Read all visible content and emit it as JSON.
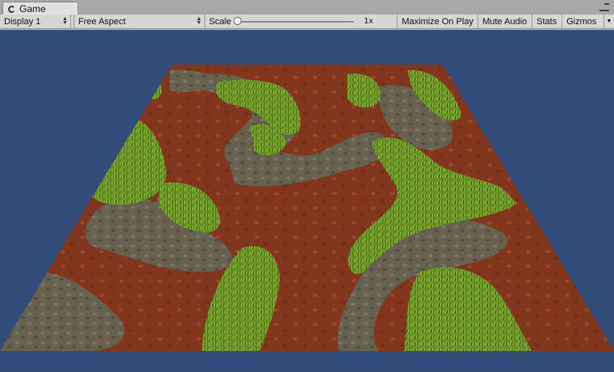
{
  "window": {
    "tab_label": "Game",
    "tab_icon": "pacman-game-icon",
    "tab_menu_icon": "tab-options-icon"
  },
  "toolbar": {
    "display_dropdown": "Display 1",
    "aspect_dropdown": "Free Aspect",
    "scale_label": "Scale",
    "scale_value": "1x",
    "scale_slider_fraction": 0.0,
    "maximize_on_play": "Maximize On Play",
    "mute_audio": "Mute Audio",
    "stats": "Stats",
    "gizmos": "Gizmos"
  },
  "scene": {
    "background_color": "#324d7a",
    "description_colors": {
      "dirt": "#8a3a1f",
      "grass": "#6f9a2a",
      "stone_path": "#6e6855"
    }
  }
}
